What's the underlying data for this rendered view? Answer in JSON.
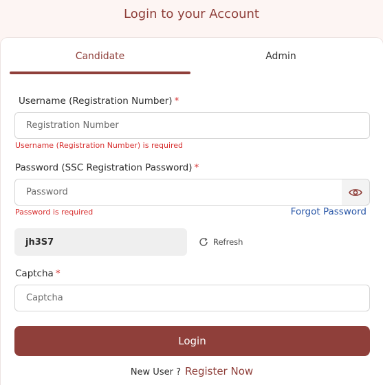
{
  "header": {
    "title": "Login to your Account"
  },
  "tabs": [
    {
      "label": "Candidate",
      "active": true
    },
    {
      "label": "Admin",
      "active": false
    }
  ],
  "username": {
    "label": "Username (Registration Number)",
    "required_mark": "*",
    "placeholder": "Registration Number",
    "value": "",
    "error": "Username (Registration Number) is required"
  },
  "password": {
    "label": "Password (SSC Registration Password)",
    "required_mark": "*",
    "placeholder": "Password",
    "value": "",
    "error": "Password is required",
    "forgot_label": "Forgot Password"
  },
  "captcha": {
    "code": "jh3S7",
    "refresh_label": "Refresh",
    "label": "Captcha",
    "required_mark": "*",
    "placeholder": "Captcha",
    "value": ""
  },
  "login_button": {
    "label": "Login"
  },
  "footer": {
    "new_user_text": "New User ?",
    "register_label": "Register Now"
  },
  "colors": {
    "brand": "#8f3f3a",
    "error": "#d62a2a",
    "link": "#2856a7",
    "page_bg": "#fdf5f3"
  },
  "icons": {
    "password_toggle": "eye-icon",
    "refresh": "refresh-icon"
  }
}
